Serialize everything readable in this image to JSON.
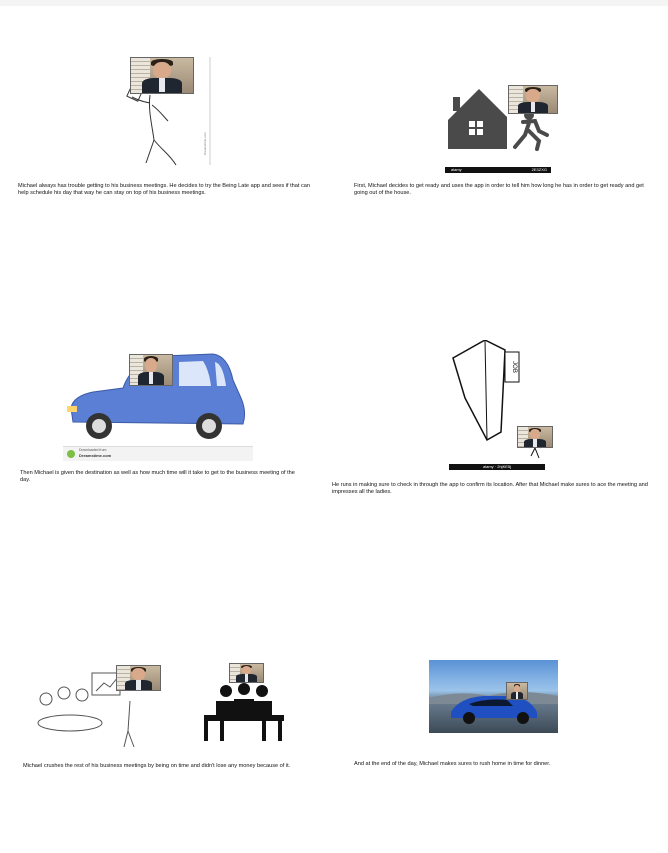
{
  "panels": [
    {
      "caption": "Michael always has trouble getting to his business meetings. He decides to try the Being Late app and sees if that can help schedule his day that way he can stay on top of his business meetings.",
      "side_label": "Dreamstime.com"
    },
    {
      "caption": "First, Michael decides to get ready and uses the app in order to tell him how long he has in order to get ready and get going out of the house.",
      "bar_left": "alamy",
      "bar_right": "2E3ZXG"
    },
    {
      "caption": "Then Michael is given the destination as well as how much time will it take to get to the business meeting of the day.",
      "download_line1": "Downloaded from",
      "download_line2": "Dreamstime.com"
    },
    {
      "caption": "He runs in making sure to check in through the app to confirm its location. After that Michael make sures to ace the meeting and impresses all the ladies.",
      "sign_text": "JOB",
      "bar_text": "alamy · 2hjKE5j"
    },
    {
      "caption": "Michael crushes the rest of his business meetings by being on time and didn't lose any money because of it."
    },
    {
      "caption": "And at the end of the day, Michael makes sures to rush home in time for dinner."
    }
  ],
  "colors": {
    "car_body": "#5b7fd4",
    "house": "#4a4a4a",
    "sky": "#4a7fbf",
    "car2": "#1f4fc0"
  }
}
